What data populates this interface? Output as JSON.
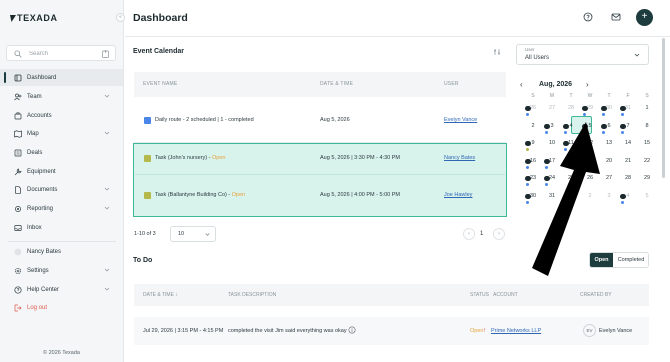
{
  "app": {
    "logo": "TEXADA",
    "footer": "© 2026 Texada"
  },
  "search": {
    "placeholder": "Search"
  },
  "nav": {
    "items": [
      {
        "label": "Dashboard",
        "icon": "dashboard-icon"
      },
      {
        "label": "Team",
        "icon": "team-icon"
      },
      {
        "label": "Accounts",
        "icon": "accounts-icon"
      },
      {
        "label": "Map",
        "icon": "map-icon"
      },
      {
        "label": "Deals",
        "icon": "deals-icon"
      },
      {
        "label": "Equipment",
        "icon": "equipment-icon"
      },
      {
        "label": "Documents",
        "icon": "documents-icon"
      },
      {
        "label": "Reporting",
        "icon": "reporting-icon"
      },
      {
        "label": "Inbox",
        "icon": "inbox-icon"
      }
    ],
    "user": "Nancy Bates",
    "settings": "Settings",
    "help": "Help Center",
    "logout": "Log out"
  },
  "header": {
    "title": "Dashboard"
  },
  "event_calendar": {
    "title": "Event Calendar",
    "columns": [
      "EVENT NAME",
      "DATE & TIME",
      "USER"
    ],
    "rows": [
      {
        "title": "Daily route - 2 scheduled | 1 - completed",
        "status": "",
        "date": "Aug 5, 2026",
        "user": "Evelyn Vance",
        "color": "#4a86e8"
      },
      {
        "title": "Task (John's nursery) - ",
        "status": "Open",
        "date": "Aug 5, 2026 | 3:30 PM - 4:30 PM",
        "user": "Nancy Bates",
        "color": "#b5b84a"
      },
      {
        "title": "Task (Ballantyne Building Co) - ",
        "status": "Open",
        "date": "Aug 5, 2026 | 4:00 PM - 5:00 PM",
        "user": "Joe Hawley",
        "color": "#b5b84a"
      }
    ],
    "pager": {
      "range": "1-10 of 3",
      "per_page": "10",
      "page": "1"
    }
  },
  "user_filter": {
    "label": "User",
    "value": "All Users"
  },
  "calendar": {
    "month": "Aug, 2026",
    "weekdays": [
      "S",
      "M",
      "T",
      "W",
      "T",
      "F",
      "S"
    ],
    "weeks": [
      [
        "26",
        "27",
        "28",
        "29",
        "30",
        "31",
        "1"
      ],
      [
        "2",
        "3",
        "4",
        "5",
        "6",
        "7",
        "8"
      ],
      [
        "9",
        "10",
        "11",
        "12",
        "13",
        "14",
        "15"
      ],
      [
        "16",
        "17",
        "18",
        "19",
        "20",
        "21",
        "22"
      ],
      [
        "23",
        "24",
        "25",
        "26",
        "27",
        "28",
        "29"
      ],
      [
        "30",
        "31",
        "1",
        "2",
        "3",
        "4",
        "5"
      ]
    ],
    "selected": "5"
  },
  "todo": {
    "title": "To Do",
    "tabs": {
      "open": "Open",
      "completed": "Completed"
    },
    "columns": [
      "DATE & TIME",
      "TASK DESCRIPTION",
      "STATUS",
      "ACCOUNT",
      "CREATED BY"
    ],
    "row": {
      "date": "Jul 29, 2026 | 3:15 PM - 4:15 PM",
      "description": "completed the visit Jim said everything was okay",
      "status": "Open",
      "account": "Prime Networks LLP",
      "initials": "EV",
      "created_by": "Evelyn Vance"
    }
  },
  "colors": {
    "accent": "#1e3b3e",
    "highlight": "#3fb79a",
    "open": "#e8a33c",
    "link": "#2f67b5",
    "logout": "#e05a4f"
  }
}
